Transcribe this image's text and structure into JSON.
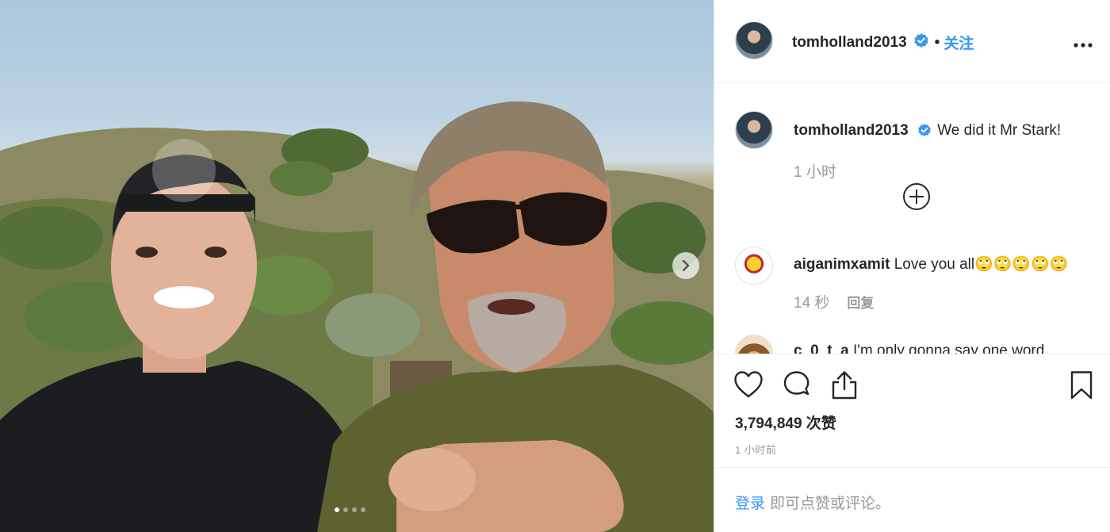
{
  "post": {
    "username": "tomholland2013",
    "follow_label": "关注",
    "dot": "•",
    "more_label": "•••",
    "caption": "We did it Mr Stark!",
    "caption_time": "1 小时"
  },
  "comments": [
    {
      "username": "aiganimxamit",
      "text": "Love you all🙄🙄🙄🙄🙄",
      "time": "14 秒",
      "reply_label": "回复"
    },
    {
      "username": "c_0_t_a",
      "text": "I'm only gonna say one word"
    }
  ],
  "actions": {
    "likes": "3,794,849 次赞",
    "posted": "1 小时前"
  },
  "login": {
    "link": "登录",
    "text": "即可点赞或评论。"
  },
  "carousel": {
    "slides": 4,
    "active": 1
  },
  "colors": {
    "accent": "#3897f0",
    "verified": "#3897f0",
    "muted": "#999999"
  }
}
